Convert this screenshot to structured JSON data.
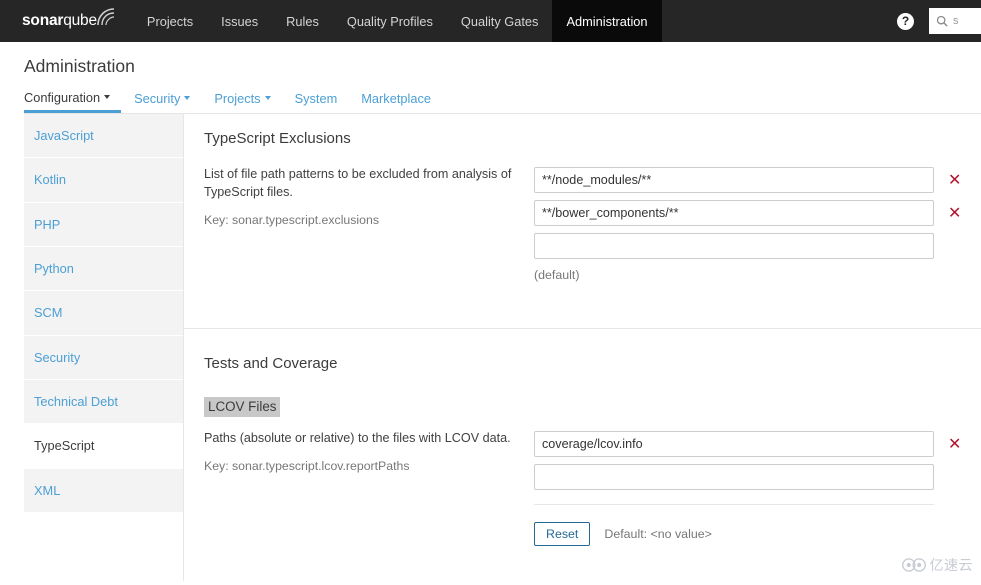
{
  "topnav": {
    "logo": {
      "bold": "sonar",
      "light": "qube"
    },
    "items": [
      {
        "label": "Projects",
        "active": false
      },
      {
        "label": "Issues",
        "active": false
      },
      {
        "label": "Rules",
        "active": false
      },
      {
        "label": "Quality Profiles",
        "active": false
      },
      {
        "label": "Quality Gates",
        "active": false
      },
      {
        "label": "Administration",
        "active": true
      }
    ],
    "help_icon": "help-icon",
    "search": {
      "icon": "search-icon",
      "value": "s",
      "placeholder": "Search"
    }
  },
  "page": {
    "title": "Administration",
    "subtabs": [
      {
        "label": "Configuration",
        "caret": true,
        "active": true
      },
      {
        "label": "Security",
        "caret": true,
        "active": false
      },
      {
        "label": "Projects",
        "caret": true,
        "active": false
      },
      {
        "label": "System",
        "caret": false,
        "active": false
      },
      {
        "label": "Marketplace",
        "caret": false,
        "active": false
      }
    ]
  },
  "sidebar": {
    "items": [
      {
        "label": "JavaScript",
        "active": false
      },
      {
        "label": "Kotlin",
        "active": false
      },
      {
        "label": "PHP",
        "active": false
      },
      {
        "label": "Python",
        "active": false
      },
      {
        "label": "SCM",
        "active": false
      },
      {
        "label": "Security",
        "active": false
      },
      {
        "label": "Technical Debt",
        "active": false
      },
      {
        "label": "TypeScript",
        "active": true
      },
      {
        "label": "XML",
        "active": false
      }
    ]
  },
  "sections": {
    "exclusions": {
      "title": "TypeScript Exclusions",
      "description": "List of file path patterns to be excluded from analysis of TypeScript files.",
      "key": "Key: sonar.typescript.exclusions",
      "values": [
        "**/node_modules/**",
        "**/bower_components/**",
        ""
      ],
      "note": "(default)",
      "delete_icon": "delete-icon"
    },
    "tests": {
      "title": "Tests and Coverage",
      "lcov_label": "LCOV Files",
      "description": "Paths (absolute or relative) to the files with LCOV data.",
      "key": "Key: sonar.typescript.lcov.reportPaths",
      "values": [
        "coverage/lcov.info",
        ""
      ],
      "reset_label": "Reset",
      "default_note": "Default: <no value>",
      "delete_icon": "delete-icon"
    }
  },
  "watermark": {
    "text": "亿速云",
    "icon": "cloud-logo-icon"
  },
  "colors": {
    "topbar_bg": "#262626",
    "active_tab_bg": "#0a0a0a",
    "link_blue": "#4b9fd5",
    "delete_red": "#b0162f",
    "button_blue": "#236a97",
    "sidebar_item_bg": "#f3f3f3"
  }
}
